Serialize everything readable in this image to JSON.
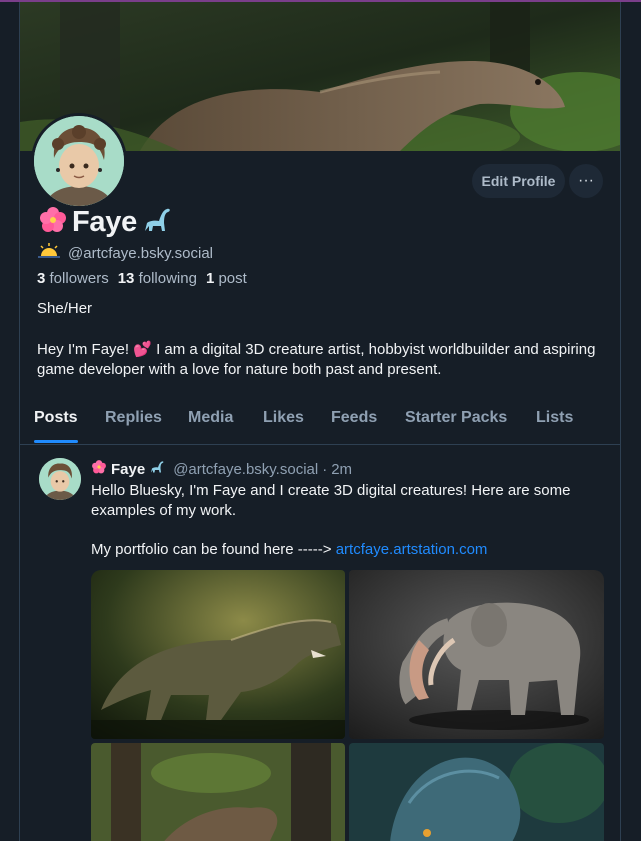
{
  "profile": {
    "display_name": "Faye",
    "handle": "@artcfaye.bsky.social",
    "edit_label": "Edit Profile",
    "more_label": "···",
    "followers_count": "3",
    "followers_label": "followers",
    "following_count": "13",
    "following_label": "following",
    "posts_count": "1",
    "posts_label": "post",
    "pronouns": "She/Her",
    "bio": "Hey I'm Faye! 💕 I am a digital 3D creature artist, hobbyist worldbuilder and aspiring game developer with a love for nature both past and present."
  },
  "tabs": [
    {
      "label": "Posts"
    },
    {
      "label": "Replies"
    },
    {
      "label": "Media"
    },
    {
      "label": "Likes"
    },
    {
      "label": "Feeds"
    },
    {
      "label": "Starter Packs"
    },
    {
      "label": "Lists"
    }
  ],
  "post": {
    "author_name": "Faye",
    "author_handle": "@artcfaye.bsky.social",
    "separator": "·",
    "time": "2m",
    "text": "Hello Bluesky, I'm Faye and I create 3D digital creatures! Here are some examples of my work.",
    "portfolio_prefix": "My portfolio can be found here -----> ",
    "portfolio_link": "artcfaye.artstation.com"
  },
  "icons": {
    "flower": "hibiscus-emoji",
    "dino": "sauropod-emoji",
    "sun": "sunrise-emoji",
    "more": "ellipsis-icon"
  },
  "colors": {
    "background": "#161e27",
    "accent": "#208bfe",
    "muted_text": "#aebbc9"
  }
}
